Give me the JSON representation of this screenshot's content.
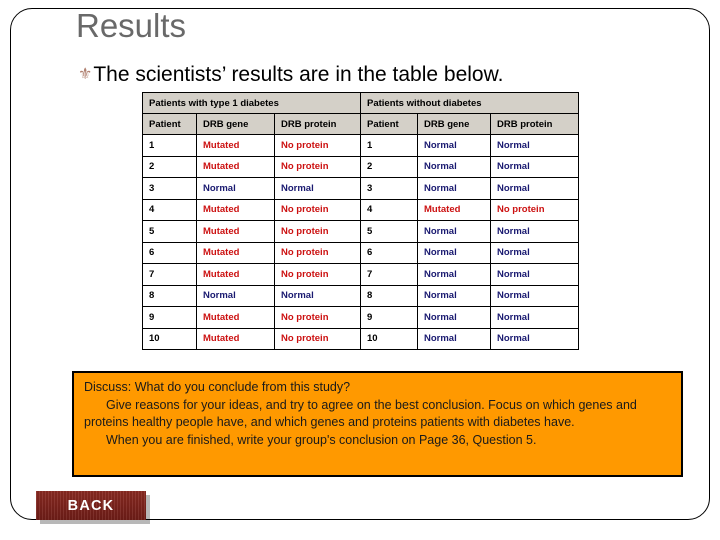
{
  "slide": {
    "title": "Results",
    "bullet_ornament": "⚜",
    "bullet_text": "The scientists’ results are in the table below.",
    "title_color": "#696969",
    "ornament_color": "#b08070"
  },
  "table": {
    "group_headers": [
      "Patients with type 1 diabetes",
      "Patients without diabetes"
    ],
    "column_headers": [
      "Patient",
      "DRB gene",
      "DRB protein",
      "Patient",
      "DRB gene",
      "DRB protein"
    ],
    "colors": {
      "mutated": "#cc1111",
      "normal": "#191970",
      "header_bg": "#d4d0c8"
    },
    "rows": [
      {
        "left": {
          "patient": "1",
          "gene": "Mutated",
          "protein": "No protein"
        },
        "right": {
          "patient": "1",
          "gene": "Normal",
          "protein": "Normal"
        }
      },
      {
        "left": {
          "patient": "2",
          "gene": "Mutated",
          "protein": "No protein"
        },
        "right": {
          "patient": "2",
          "gene": "Normal",
          "protein": "Normal"
        }
      },
      {
        "left": {
          "patient": "3",
          "gene": "Normal",
          "protein": "Normal"
        },
        "right": {
          "patient": "3",
          "gene": "Normal",
          "protein": "Normal"
        }
      },
      {
        "left": {
          "patient": "4",
          "gene": "Mutated",
          "protein": "No protein"
        },
        "right": {
          "patient": "4",
          "gene": "Mutated",
          "protein": "No protein"
        }
      },
      {
        "left": {
          "patient": "5",
          "gene": "Mutated",
          "protein": "No protein"
        },
        "right": {
          "patient": "5",
          "gene": "Normal",
          "protein": "Normal"
        }
      },
      {
        "left": {
          "patient": "6",
          "gene": "Mutated",
          "protein": "No protein"
        },
        "right": {
          "patient": "6",
          "gene": "Normal",
          "protein": "Normal"
        }
      },
      {
        "left": {
          "patient": "7",
          "gene": "Mutated",
          "protein": "No protein"
        },
        "right": {
          "patient": "7",
          "gene": "Normal",
          "protein": "Normal"
        }
      },
      {
        "left": {
          "patient": "8",
          "gene": "Normal",
          "protein": "Normal"
        },
        "right": {
          "patient": "8",
          "gene": "Normal",
          "protein": "Normal"
        }
      },
      {
        "left": {
          "patient": "9",
          "gene": "Mutated",
          "protein": "No protein"
        },
        "right": {
          "patient": "9",
          "gene": "Normal",
          "protein": "Normal"
        }
      },
      {
        "left": {
          "patient": "10",
          "gene": "Mutated",
          "protein": "No protein"
        },
        "right": {
          "patient": "10",
          "gene": "Normal",
          "protein": "Normal"
        }
      }
    ]
  },
  "discussion": {
    "background_color": "#FF9900",
    "line1": "Discuss: What do you conclude from this study?",
    "line2": "Give reasons for your ideas, and try to agree on the best conclusion. Focus on which genes and proteins healthy people have, and which genes and proteins patients with diabetes have.",
    "line3": "When you are finished, write your group's conclusion on Page 36, Question 5."
  },
  "navigation": {
    "back_label": "BACK",
    "back_color": "#7a231b"
  }
}
